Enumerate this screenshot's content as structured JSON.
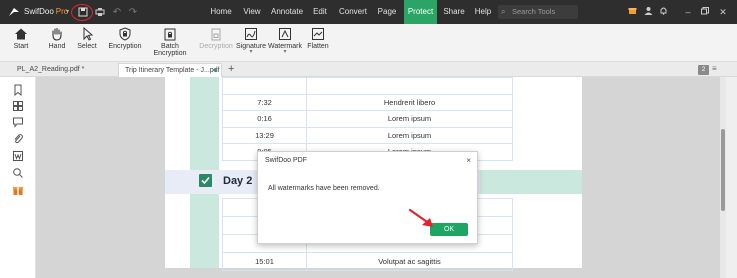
{
  "app": {
    "name": "SwifDoo",
    "edition": "Pro",
    "caret": "▾"
  },
  "menus": [
    {
      "label": "Home"
    },
    {
      "label": "View"
    },
    {
      "label": "Annotate"
    },
    {
      "label": "Edit"
    },
    {
      "label": "Convert"
    },
    {
      "label": "Page"
    },
    {
      "label": "Protect"
    },
    {
      "label": "Share"
    },
    {
      "label": "Help"
    }
  ],
  "active_menu": "Protect",
  "search": {
    "placeholder": "Search Tools"
  },
  "ribbon": {
    "tools": [
      {
        "label": "Start",
        "icon": "home-icon"
      },
      {
        "label": "Hand",
        "icon": "hand-icon"
      },
      {
        "label": "Select",
        "icon": "cursor-icon"
      },
      {
        "label": "Encryption",
        "icon": "lock-shield-icon"
      },
      {
        "label": "Batch Encryption",
        "icon": "batch-lock-icon"
      },
      {
        "label": "Decryption",
        "icon": "unlock-icon"
      },
      {
        "label": "Signature",
        "icon": "signature-icon"
      },
      {
        "label": "Watermark",
        "icon": "watermark-icon"
      },
      {
        "label": "Flatten",
        "icon": "flatten-icon"
      }
    ],
    "sub_marker": "▾"
  },
  "tabs": [
    {
      "label": "PL_A2_Reading.pdf *"
    },
    {
      "label": "Trip Itinerary Template - J...pdf *",
      "close": "●"
    }
  ],
  "tab_add": "+",
  "tab_counter": "2",
  "table1": [
    {
      "time": "",
      "text": ""
    },
    {
      "time": "7:32",
      "text": "Hendrerit libero"
    },
    {
      "time": "0:16",
      "text": "Lorem ipsum"
    },
    {
      "time": "13:29",
      "text": "Lorem ipsum"
    },
    {
      "time": "9:05",
      "text": "Lorem ipsum"
    }
  ],
  "day": {
    "label": "Day 2"
  },
  "table2": [
    {
      "time": "",
      "text": ""
    },
    {
      "time": "",
      "text": ""
    },
    {
      "time": "",
      "text": ""
    },
    {
      "time": "15:01",
      "text": "Volutpat ac sagittis"
    }
  ],
  "dialog": {
    "title": "SwifDoo PDF",
    "message": "All watermarks have been removed.",
    "ok_label": "OK",
    "close": "×"
  },
  "colors": {
    "accent": "#1fa464",
    "titlebar": "#2e2e2e",
    "highlight_red": "#e0262c",
    "teal_stripe": "#cbe8df",
    "check_green": "#2a8a66"
  }
}
